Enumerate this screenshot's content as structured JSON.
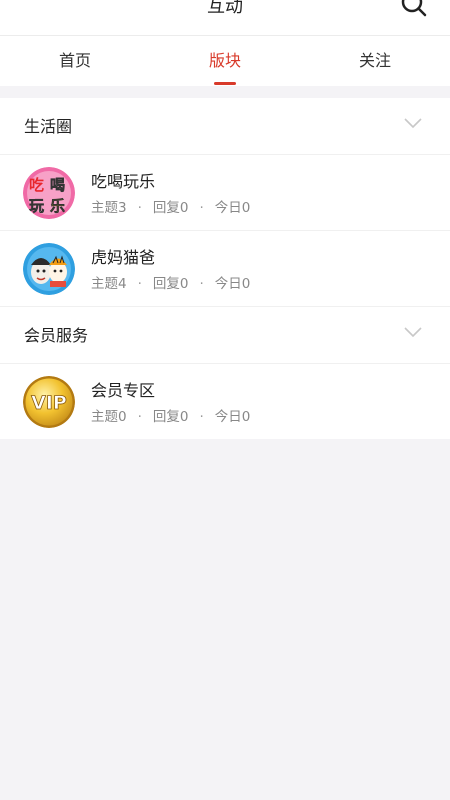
{
  "header": {
    "title": "互动",
    "search_icon": "search-icon"
  },
  "tabs": [
    {
      "label": "首页",
      "active": false
    },
    {
      "label": "版块",
      "active": true
    },
    {
      "label": "关注",
      "active": false
    }
  ],
  "accent_color": "#d83a2a",
  "sections": [
    {
      "title": "生活圈",
      "forums": [
        {
          "name": "吃喝玩乐",
          "topics": "主题3",
          "replies": "回复0",
          "today": "今日0",
          "icon": "chihewanle-logo",
          "icon_text": "吃喝玩乐"
        },
        {
          "name": "虎妈猫爸",
          "topics": "主题4",
          "replies": "回复0",
          "today": "今日0",
          "icon": "parents-cartoon-logo"
        }
      ]
    },
    {
      "title": "会员服务",
      "forums": [
        {
          "name": "会员专区",
          "topics": "主题0",
          "replies": "回复0",
          "today": "今日0",
          "icon": "vip-badge-logo",
          "icon_text": "VIP"
        }
      ]
    }
  ]
}
